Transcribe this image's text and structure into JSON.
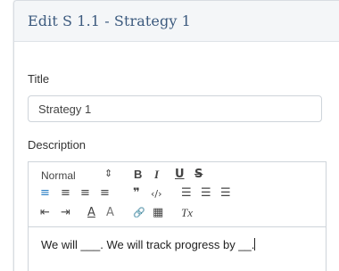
{
  "header": {
    "title": "Edit S 1.1 - Strategy 1"
  },
  "title_field": {
    "label": "Title",
    "value": "Strategy 1"
  },
  "description_field": {
    "label": "Description",
    "header_select": "Normal",
    "content": "We will ___. We will track progress by __."
  },
  "toolbar_icons": {
    "bold": "B",
    "italic": "I",
    "underline": "U",
    "strike": "S",
    "align_left": "≡",
    "align_center": "≡",
    "align_right": "≡",
    "align_justify": "≡",
    "blockquote": "❞",
    "code": "‹/›",
    "ordered_list": "☰",
    "bullet_list": "☰",
    "check_list": "☰",
    "outdent": "⇤",
    "indent": "⇥",
    "text_color": "A",
    "highlight": "A",
    "link": "🔗",
    "image": "▦",
    "clear_format": "Tx"
  },
  "colors": {
    "title": "#3c5a7e",
    "active": "#2b7fc4",
    "header_bg": "#f4f6f8"
  }
}
